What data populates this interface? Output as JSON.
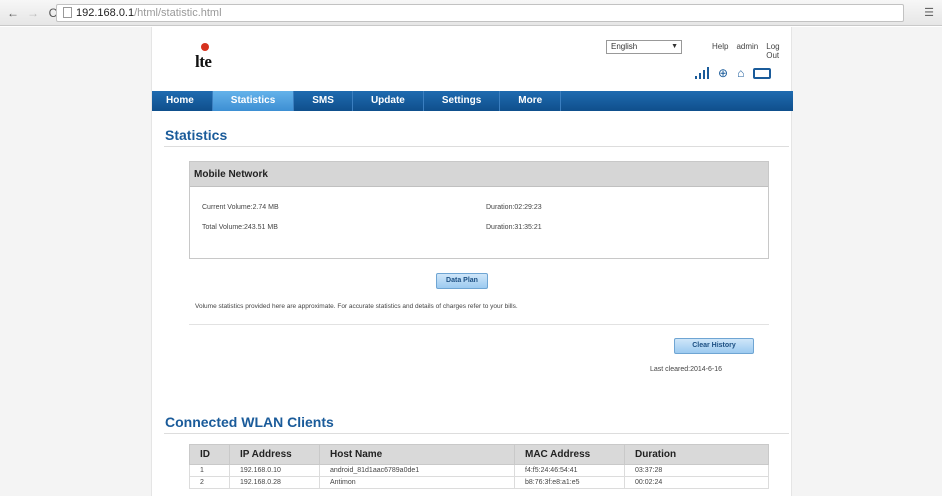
{
  "browser": {
    "back": "←",
    "forward": "→",
    "reload": "C",
    "url_host": "192.168.0.1",
    "url_path": "/html/statistic.html",
    "right_label": "☰"
  },
  "header": {
    "logo_text": "lte",
    "language": "English",
    "links": [
      "Help",
      "admin",
      "Log Out"
    ],
    "icons": [
      "signal-icon",
      "globe-icon",
      "wifi-icon",
      "battery-icon"
    ]
  },
  "menu": {
    "items": [
      "Home",
      "Statistics",
      "SMS",
      "Update",
      "Settings",
      "More"
    ],
    "active": "Statistics"
  },
  "statistics": {
    "title": "Statistics",
    "box_header": "Mobile Network",
    "current_volume": "Current Volume:2.74 MB",
    "current_duration": "Duration:02:29:23",
    "total_volume": "Total Volume:243.51 MB",
    "total_duration": "Duration:31:35:21",
    "data_plan_button": "Data Plan",
    "note": "Volume statistics provided here are approximate. For accurate statistics and details of charges refer to your bills.",
    "clear_history_button": "Clear History",
    "last_cleared": "Last cleared:2014-6-16"
  },
  "wlan": {
    "title": "Connected WLAN Clients",
    "columns": [
      "ID",
      "IP Address",
      "Host Name",
      "MAC Address",
      "Duration"
    ],
    "rows": [
      [
        "1",
        "192.168.0.10",
        "android_81d1aac6789a0de1",
        "f4:f5:24:46:54:41",
        "03:37:28"
      ],
      [
        "2",
        "192.168.0.28",
        "Antimon",
        "b8:76:3f:e8:a1:e5",
        "00:02:24"
      ]
    ]
  },
  "colors": {
    "accent": "#1a5b9a",
    "menu_bg": "#0f4f8c",
    "menu_active": "#4a9ade"
  }
}
